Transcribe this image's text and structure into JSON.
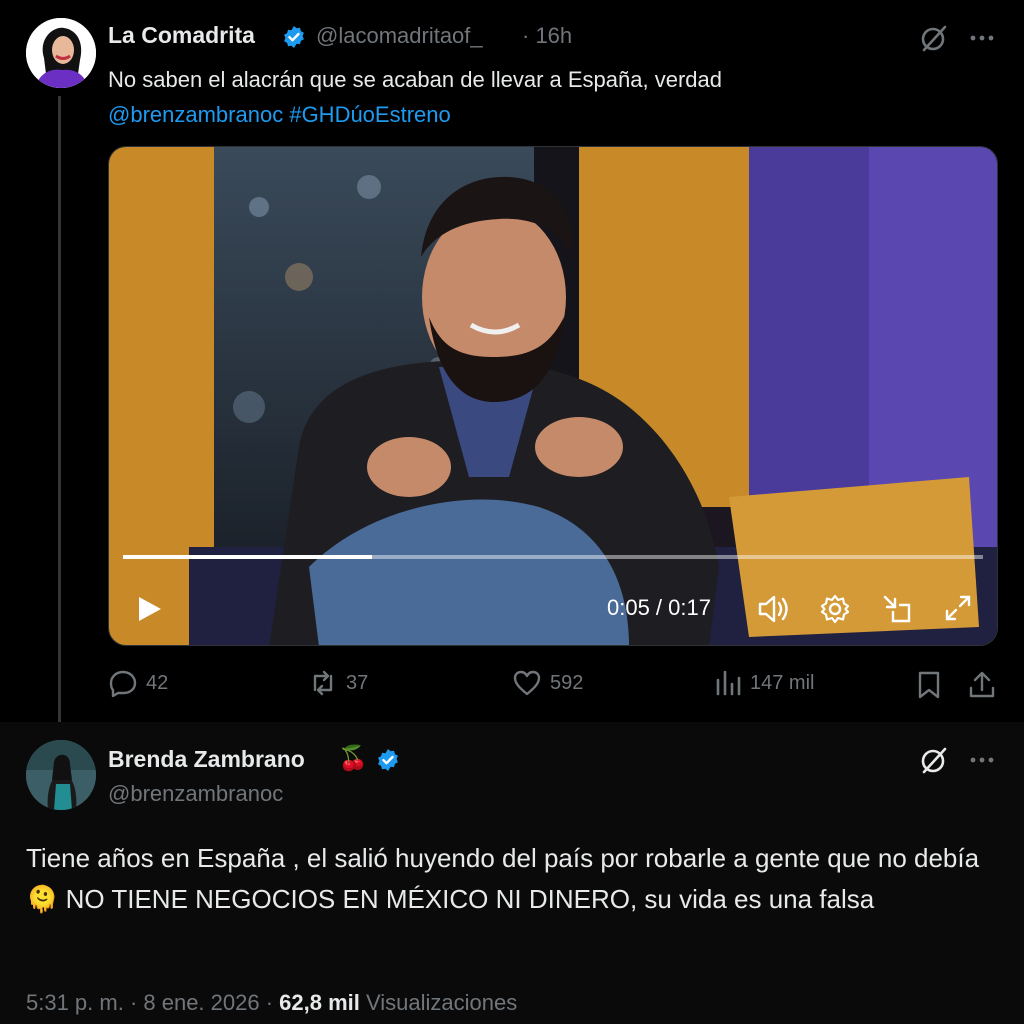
{
  "quoted_tweet": {
    "author_name": "La Comadrita",
    "handle": "@lacomadritaof_",
    "time": "· 16h",
    "text": "No saben el alacrán que se acaban de llevar a España, verdad",
    "mention": "@brenzambranoc",
    "hashtag": "#GHDúoEstreno",
    "video": {
      "current_time": "0:05",
      "duration": "0:17",
      "time_display": "0:05 / 0:17",
      "progress": 0.29
    },
    "actions": {
      "replies": "42",
      "reposts": "37",
      "likes": "592",
      "views": "147 mil"
    }
  },
  "main_tweet": {
    "author_name": "Brenda Zambrano",
    "name_emoji": "🍒",
    "handle": "@brenzambranoc",
    "text": "Tiene años en España  , el salió huyendo del país por robarle a gente que no debía  🫠 NO TIENE NEGOCIOS EN MÉXICO NI DINERO, su vida es una falsa",
    "timestamp": "5:31 p. m. · 8 ene. 2026 · ",
    "views_count": "62,8 mil",
    "views_label": " Visualizaciones"
  },
  "colors": {
    "link": "#1d9bf0",
    "verified": "#1d9bf0",
    "muted": "#71767b",
    "text": "#e7e9ea"
  }
}
